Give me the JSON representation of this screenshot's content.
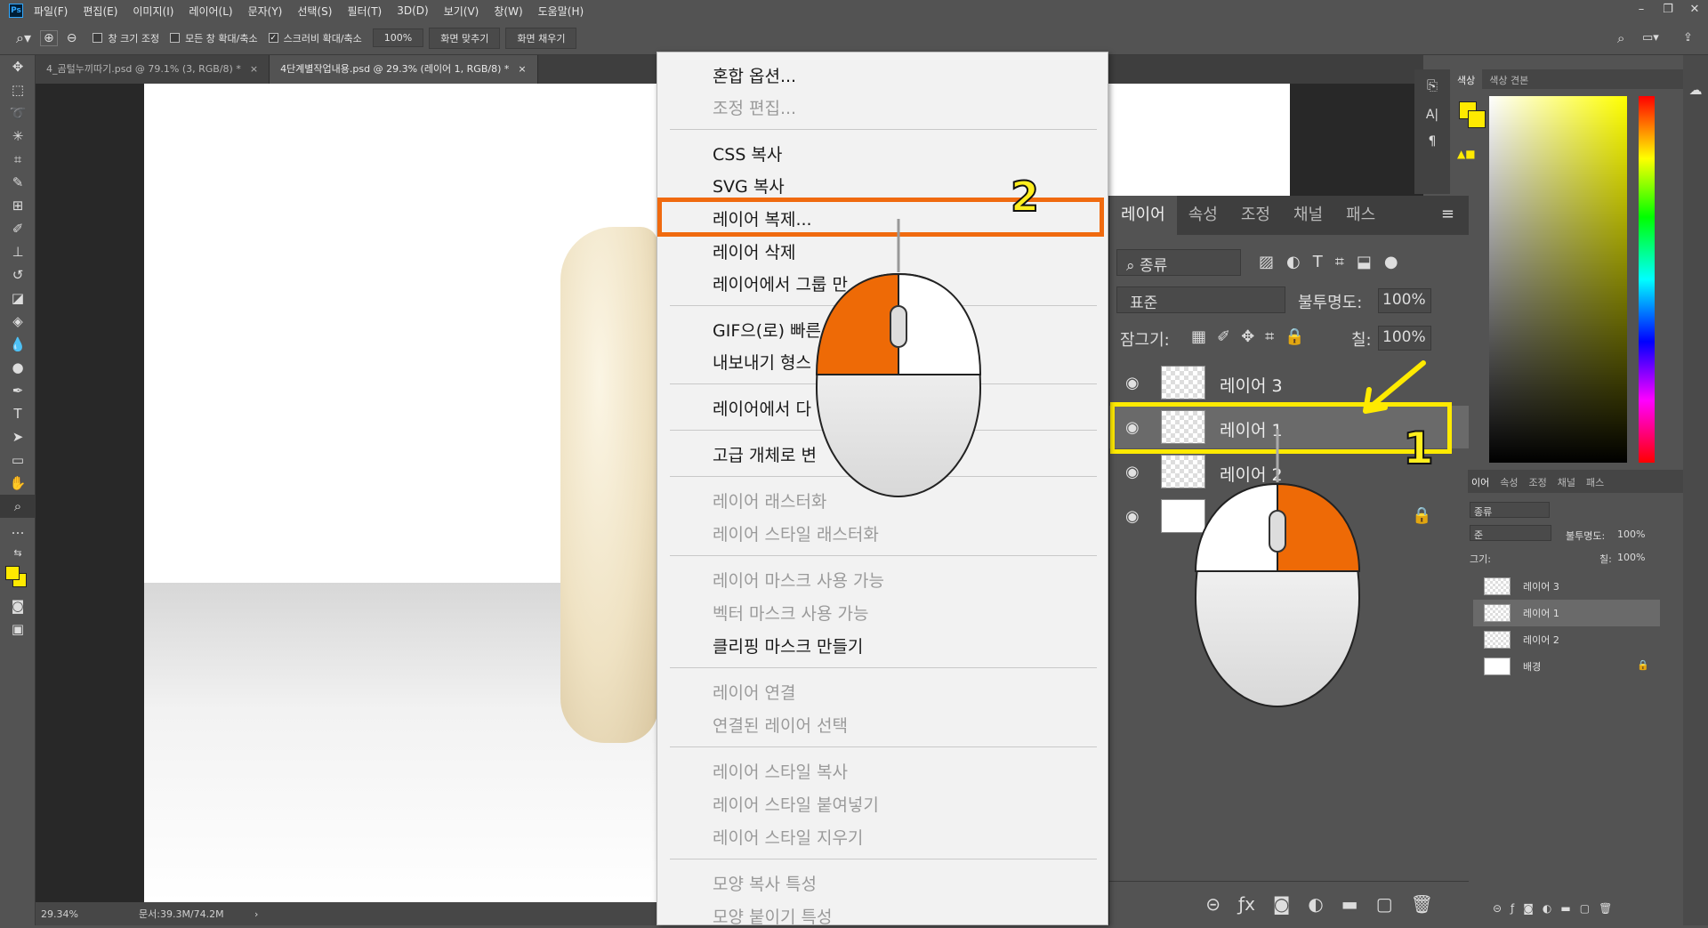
{
  "menubar": {
    "app_icon": "Ps",
    "items": [
      "파일(F)",
      "편집(E)",
      "이미지(I)",
      "레이어(L)",
      "문자(Y)",
      "선택(S)",
      "필터(T)",
      "3D(D)",
      "보기(V)",
      "창(W)",
      "도움말(H)"
    ]
  },
  "options": {
    "resize_windows": "창 크기 조정",
    "zoom_all": "모든 창 확대/축소",
    "scrubby_zoom": "스크러비 확대/축소",
    "zoom_value": "100%",
    "fit_screen": "화면 맞추기",
    "fill_screen": "화면 채우기"
  },
  "tabs": [
    {
      "label": "4_곰털누끼따기.psd @ 79.1% (3, RGB/8) *",
      "close": "×"
    },
    {
      "label": "4단계별작업내용.psd @ 29.3% (레이어 1, RGB/8) *",
      "close": "×"
    }
  ],
  "status": {
    "zoom": "29.34%",
    "doc": "문서:39.3M/74.2M",
    "arrow": "›"
  },
  "context_menu": {
    "items": [
      {
        "label": "혼합 옵션...",
        "enabled": true
      },
      {
        "label": "조정 편집...",
        "enabled": false
      },
      {
        "label": "CSS 복사",
        "enabled": true
      },
      {
        "label": "SVG 복사",
        "enabled": true
      },
      {
        "label": "레이어 복제...",
        "enabled": true
      },
      {
        "label": "레이어 삭제",
        "enabled": true
      },
      {
        "label": "레이어에서 그룹 만",
        "enabled": true
      },
      {
        "label": "GIF으(로) 빠른",
        "enabled": true
      },
      {
        "label": "내보내기 형스",
        "enabled": true
      },
      {
        "label": "레이어에서 다",
        "enabled": true
      },
      {
        "label": "고급 개체로 변",
        "enabled": true
      },
      {
        "label": "레이어 래스터화",
        "enabled": false
      },
      {
        "label": "레이어 스타일 래스터화",
        "enabled": false
      },
      {
        "label": "레이어 마스크 사용 가능",
        "enabled": false
      },
      {
        "label": "벡터 마스크 사용 가능",
        "enabled": false
      },
      {
        "label": "클리핑 마스크 만들기",
        "enabled": true
      },
      {
        "label": "레이어 연결",
        "enabled": false
      },
      {
        "label": "연결된 레이어 선택",
        "enabled": false
      },
      {
        "label": "레이어 스타일 복사",
        "enabled": false
      },
      {
        "label": "레이어 스타일 붙여넣기",
        "enabled": false
      },
      {
        "label": "레이어 스타일 지우기",
        "enabled": false
      },
      {
        "label": "모양 복사 특성",
        "enabled": false
      },
      {
        "label": "모양 붙이기 특성",
        "enabled": false
      }
    ]
  },
  "annotations": {
    "step1": "1",
    "step2": "2",
    "highlight_color": "#f06a0f",
    "marker_color": "#ffea00"
  },
  "layers_panel": {
    "tabs": [
      "레이어",
      "속성",
      "조정",
      "채널",
      "패스"
    ],
    "filter": "종류",
    "blend_mode": "표준",
    "opacity_label": "불투명도:",
    "opacity": "100%",
    "lock_label": "잠그기:",
    "fill_label": "칠:",
    "fill": "100%",
    "layers": [
      {
        "name": "레이어 3",
        "selected": false
      },
      {
        "name": "레이어 1",
        "selected": true
      },
      {
        "name": "레이어 2",
        "selected": false
      },
      {
        "name": "배경",
        "selected": false,
        "locked": true
      }
    ]
  },
  "color_panel": {
    "tabs": [
      "색상",
      "색상 견본"
    ],
    "foreground": "#ffea00",
    "background": "#ffea00"
  },
  "mini_layers": {
    "tabs": [
      "이어",
      "속성",
      "조정",
      "채널",
      "패스"
    ],
    "filter": "종류",
    "blend": "준",
    "opacity_label": "불투명도:",
    "opacity": "100%",
    "lock_label": "그기:",
    "fill_label": "칠:",
    "fill": "100%",
    "layers": [
      "레이어 3",
      "레이어 1",
      "레이어 2",
      "배경"
    ]
  }
}
